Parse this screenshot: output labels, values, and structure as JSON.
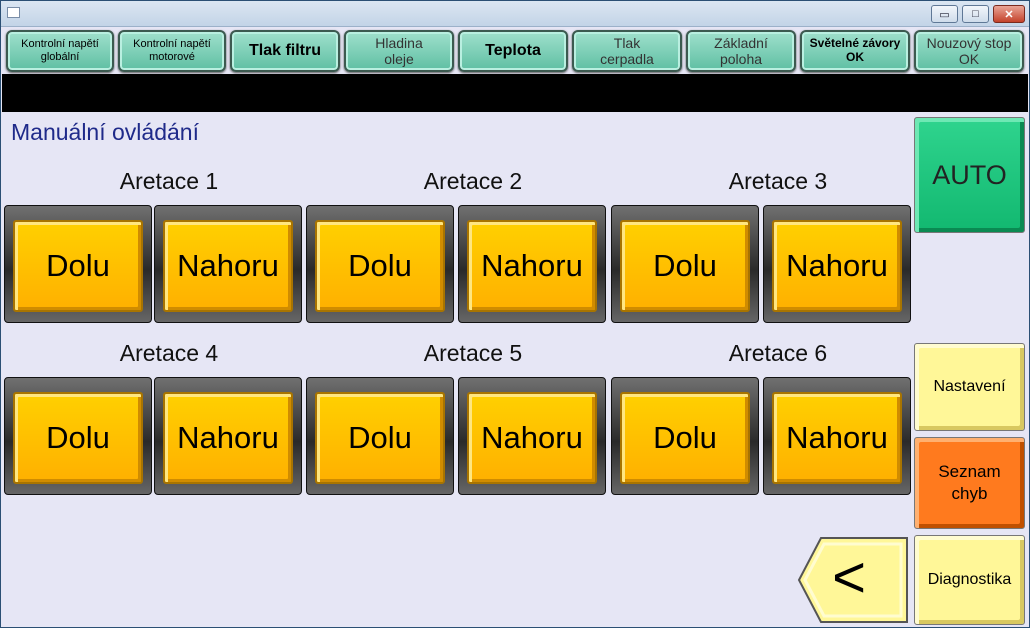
{
  "window": {
    "minimize": "▭",
    "maximize": "□",
    "close": "✕"
  },
  "toolbar": [
    {
      "line1": "Kontrolní napětí",
      "line2": "globální"
    },
    {
      "line1": "Kontrolní napětí",
      "line2": "motorové"
    },
    {
      "line1": "Tlak filtru",
      "line2": ""
    },
    {
      "line1": "Hladina",
      "line2": "oleje"
    },
    {
      "line1": "Teplota",
      "line2": ""
    },
    {
      "line1": "Tlak",
      "line2": "cerpadla"
    },
    {
      "line1": "Základní",
      "line2": "poloha"
    },
    {
      "line1": "Světelné závory",
      "line2": "OK"
    },
    {
      "line1": "Nouzový stop",
      "line2": "OK"
    }
  ],
  "main": {
    "title": "Manuální ovládání",
    "groups": [
      {
        "label": "Aretace 1",
        "down": "Dolu",
        "up": "Nahoru"
      },
      {
        "label": "Aretace 2",
        "down": "Dolu",
        "up": "Nahoru"
      },
      {
        "label": "Aretace 3",
        "down": "Dolu",
        "up": "Nahoru"
      },
      {
        "label": "Aretace 4",
        "down": "Dolu",
        "up": "Nahoru"
      },
      {
        "label": "Aretace 5",
        "down": "Dolu",
        "up": "Nahoru"
      },
      {
        "label": "Aretace 6",
        "down": "Dolu",
        "up": "Nahoru"
      }
    ]
  },
  "side": {
    "auto": "AUTO",
    "settings": "Nastavení",
    "errors_line1": "Seznam",
    "errors_line2": "chyb",
    "diagnostics": "Diagnostika",
    "back": "<"
  },
  "colors": {
    "toolbar": "#7fd0b6",
    "action": "#ffc000",
    "auto": "#20c880",
    "errors": "#ff7a1e",
    "pale": "#fff798"
  }
}
